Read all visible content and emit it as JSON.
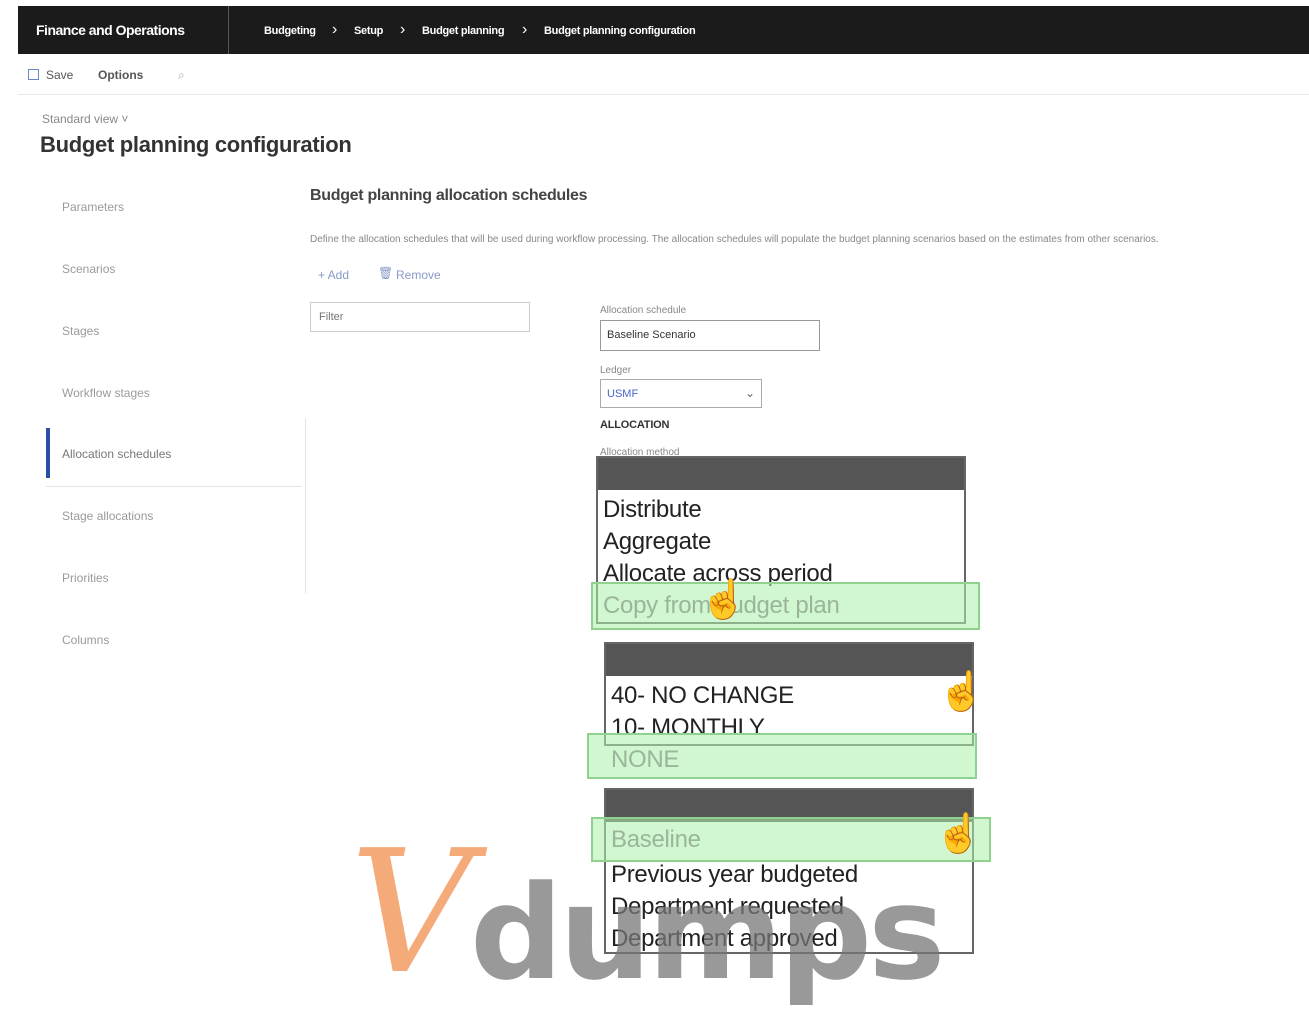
{
  "app_title": "Finance and Operations",
  "breadcrumbs": [
    "Budgeting",
    "Setup",
    "Budget planning",
    "Budget planning configuration"
  ],
  "actions": {
    "save_label": "Save",
    "options_label": "Options"
  },
  "standard_view": "Standard view ˅",
  "page_title": "Budget planning configuration",
  "nav": {
    "items": [
      "Parameters",
      "Scenarios",
      "Stages",
      "Workflow stages",
      "Allocation schedules",
      "Stage allocations",
      "Priorities",
      "Columns"
    ],
    "selected": "Allocation schedules"
  },
  "section": {
    "title": "Budget planning allocation schedules",
    "description": "Define the allocation schedules that will be used during workflow processing. The allocation schedules will populate the budget planning scenarios based on the estimates from other scenarios."
  },
  "list_toolbar": {
    "add_label": "+ Add",
    "remove_label": "Remove"
  },
  "filter": {
    "placeholder": "Filter"
  },
  "form": {
    "allocation_schedule_label": "Allocation schedule",
    "allocation_schedule_value": "Baseline Scenario",
    "ledger_label": "Ledger",
    "ledger_value": "USMF",
    "allocation_heading": "ALLOCATION",
    "allocation_method_label": "Allocation method"
  },
  "allocation_method_options": [
    "Distribute",
    "Aggregate",
    "Allocate across period",
    "Copy from budget plan"
  ],
  "allocation_method_selected": "Copy from budget plan",
  "period_options": [
    "40- NO CHANGE",
    "10- MONTHLY",
    "NONE"
  ],
  "period_selected": "NONE",
  "scenario_options": [
    "Baseline",
    "Previous year budgeted",
    "Department requested",
    "Department approved"
  ],
  "scenario_selected": "Baseline",
  "watermark": {
    "v": "V",
    "text": "dumps",
    "color_v": "#f3a26b",
    "color_text": "#777777"
  },
  "colors": {
    "topbar": "#1b1b1b",
    "nav_accent": "#2b4fa8",
    "highlight": "#aaf0aa"
  }
}
